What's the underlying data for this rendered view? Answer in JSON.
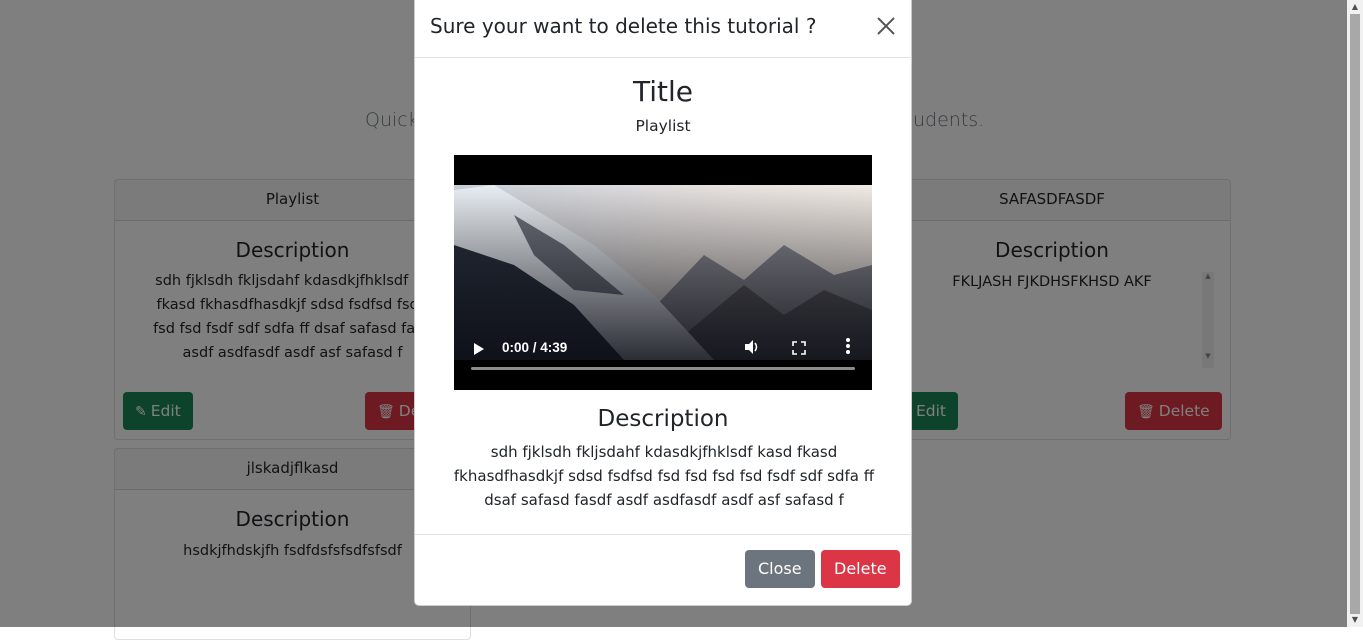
{
  "page": {
    "subtitle_left": "Quick",
    "subtitle_right": "udents."
  },
  "cards": [
    {
      "header": "Playlist",
      "title": "Description",
      "text": "sdh fjklsdh fkljsdahf kdasdkjfhklsdf kasd fkasd fkhasdfhasdkjf sdsd fsdfsd fsd fsd fsd fsd fsdf sdf sdfa ff dsaf safasd fasdf asdf asdfasdf asdf asf safasd f",
      "text_visible_lines": [
        "sdh fjklsdh fkljsdahf kdasdkjfhklsdf ka",
        "fkasd fkhasdfhasdkjf sdsd fsdfsd fsd f",
        "fsd fsd fsdf sdf sdfa ff dsaf safasd fasd",
        "asdf asdfasdf asdf asf safasd f"
      ],
      "edit_label": "Edit",
      "delete_label": "De"
    },
    {
      "header": "SAFASDFASDF",
      "title": "Description",
      "text": "FKLJASH FJKDHSFKHSD AKF",
      "edit_label": "Edit",
      "delete_label": "Delete"
    },
    {
      "header": "jlskadjflkasd",
      "title": "Description",
      "text": "hsdkjfhdskjfh fsdfdsfsfsdfsfsdf"
    }
  ],
  "modal": {
    "title": "Sure your want to delete this tutorial ?",
    "tutorial_title": "Title",
    "playlist": "Playlist",
    "video": {
      "time": "0:00 / 4:39"
    },
    "description_heading": "Description",
    "description": "sdh fjklsdh fkljsdahf kdasdkjfhklsdf kasd fkasd fkhasdfhasdkjf sdsd fsdfsd fsd fsd fsd fsd fsdf sdf sdfa ff dsaf safasd fasdf asdf asdfasdf asdf asf safasd f",
    "close_label": "Close",
    "delete_label": "Delete"
  },
  "colors": {
    "edit": "#198754",
    "delete": "#dc3545",
    "close": "#6c757d",
    "backdrop": "rgba(0,0,0,0.5)"
  }
}
